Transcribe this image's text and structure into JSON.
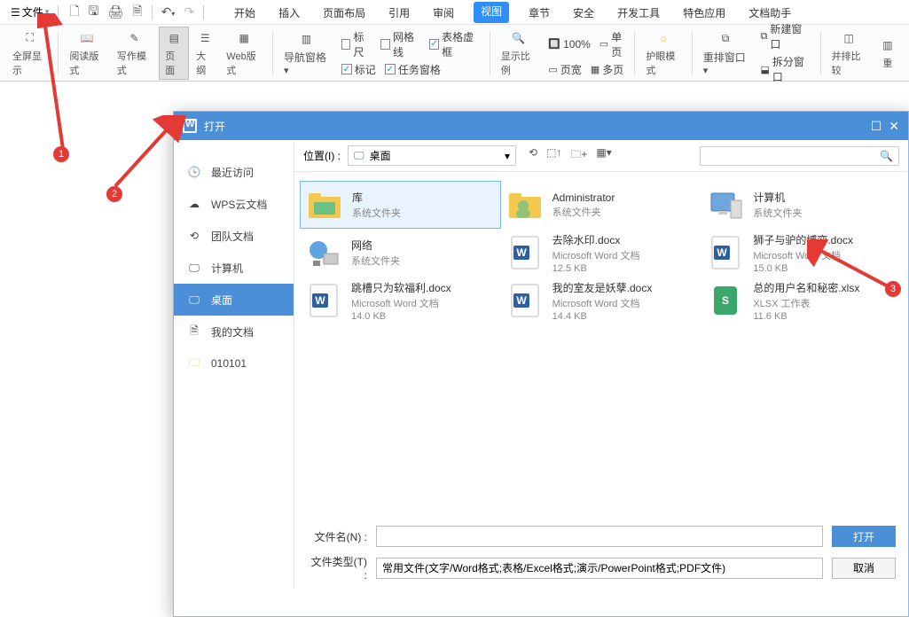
{
  "topbar": {
    "file": "文件"
  },
  "tabs": [
    "开始",
    "插入",
    "页面布局",
    "引用",
    "审阅",
    "视图",
    "章节",
    "安全",
    "开发工具",
    "特色应用",
    "文档助手"
  ],
  "active_tab": 5,
  "ribbon": {
    "fullscreen": "全屏显示",
    "read": "阅读版式",
    "write": "写作模式",
    "page": "页面",
    "outline": "大纲",
    "web": "Web版式",
    "nav": "导航窗格",
    "ruler": "标尺",
    "gridlines": "网格线",
    "tabledash": "表格虚框",
    "markup": "标记",
    "taskpane": "任务窗格",
    "zoom": "显示比例",
    "pct": "100%",
    "pagewidth": "页宽",
    "singlepage": "单页",
    "multipage": "多页",
    "eyecare": "护眼模式",
    "rearrange": "重排窗口",
    "newwin": "新建窗口",
    "splitwin": "拆分窗口",
    "compare": "并排比较",
    "resetpos": "重"
  },
  "dialog_title": "打开",
  "side": [
    {
      "k": "recent",
      "label": "最近访问"
    },
    {
      "k": "wpscloud",
      "label": "WPS云文档"
    },
    {
      "k": "team",
      "label": "团队文档"
    },
    {
      "k": "computer",
      "label": "计算机"
    },
    {
      "k": "desktop",
      "label": "桌面"
    },
    {
      "k": "mydocs",
      "label": "我的文档"
    },
    {
      "k": "folder",
      "label": "010101"
    }
  ],
  "active_side": 4,
  "loc": {
    "label": "位置(I) :",
    "value": "桌面"
  },
  "items": [
    {
      "type": "libs",
      "name": "库",
      "meta": "系统文件夹"
    },
    {
      "type": "user",
      "name": "Administrator",
      "meta": "系统文件夹"
    },
    {
      "type": "pc",
      "name": "计算机",
      "meta": "系统文件夹"
    },
    {
      "type": "net",
      "name": "网络",
      "meta": "系统文件夹"
    },
    {
      "type": "docx",
      "name": "去除水印.docx",
      "meta": "Microsoft Word 文档",
      "size": "12.5 KB"
    },
    {
      "type": "docx",
      "name": "狮子与驴的博弈.docx",
      "meta": "Microsoft Word 文档",
      "size": "15.0 KB"
    },
    {
      "type": "docx",
      "name": "跳槽只为软福利.docx",
      "meta": "Microsoft Word 文档",
      "size": "14.0 KB"
    },
    {
      "type": "docx",
      "name": "我的室友是妖孽.docx",
      "meta": "Microsoft Word 文档",
      "size": "14.4 KB"
    },
    {
      "type": "xlsx",
      "name": "总的用户名和秘密.xlsx",
      "meta": "XLSX 工作表",
      "size": "11.6 KB"
    }
  ],
  "filename_label": "文件名(N) :",
  "filetype_label": "文件类型(T) :",
  "filetype_value": "常用文件(文字/Word格式;表格/Excel格式;演示/PowerPoint格式;PDF文件)",
  "open_btn": "打开",
  "cancel_btn": "取消",
  "badges": [
    "1",
    "2",
    "3"
  ]
}
